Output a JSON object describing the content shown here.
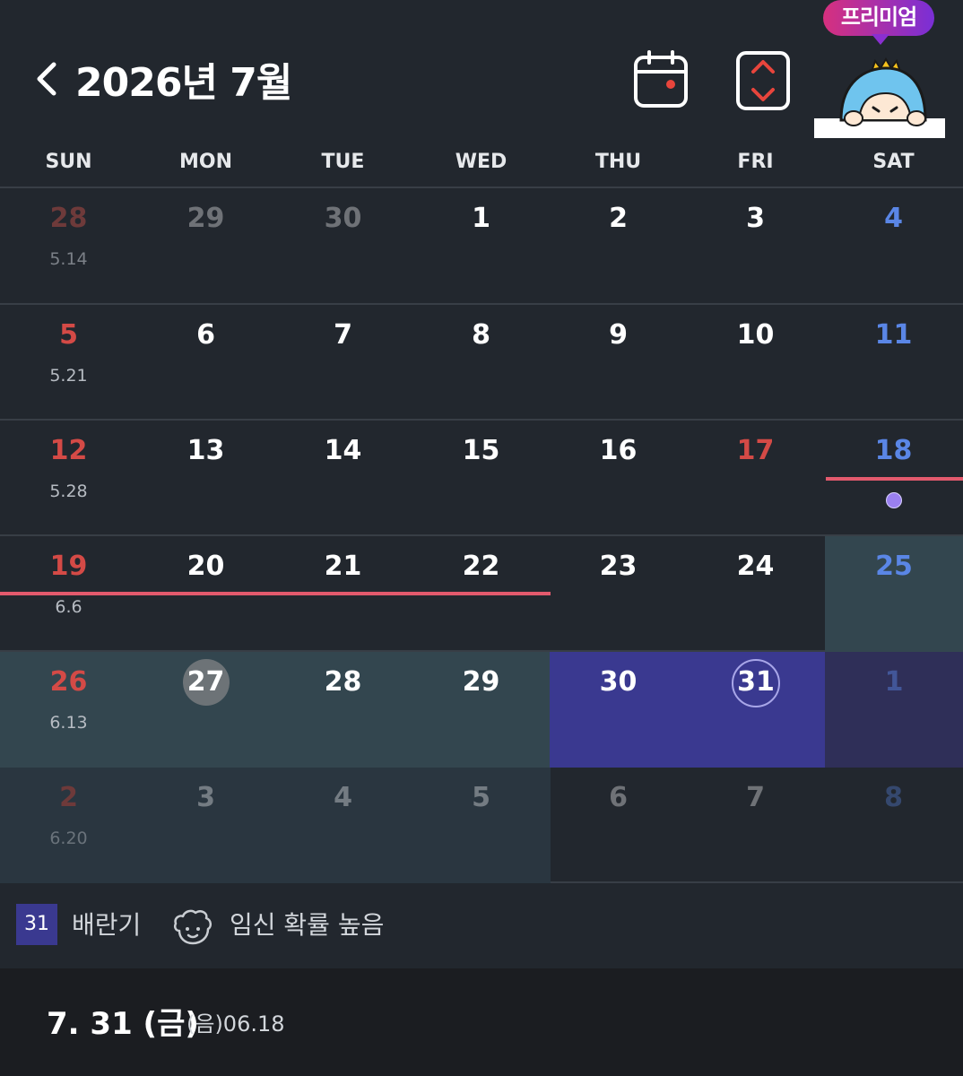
{
  "header": {
    "title": "2026년 7월",
    "back_icon": "chevron-left-icon",
    "calendar_icon": "calendar-icon",
    "expand_icon": "expand-collapse-icon",
    "premium_label": "프리미엄"
  },
  "weekdays": [
    "SUN",
    "MON",
    "TUE",
    "WED",
    "THU",
    "FRI",
    "SAT"
  ],
  "weeks": [
    [
      {
        "d": "28",
        "l": "5.14"
      },
      {
        "d": "29"
      },
      {
        "d": "30"
      },
      {
        "d": "1"
      },
      {
        "d": "2"
      },
      {
        "d": "3"
      },
      {
        "d": "4"
      }
    ],
    [
      {
        "d": "5",
        "l": "5.21"
      },
      {
        "d": "6"
      },
      {
        "d": "7"
      },
      {
        "d": "8"
      },
      {
        "d": "9"
      },
      {
        "d": "10"
      },
      {
        "d": "11"
      }
    ],
    [
      {
        "d": "12",
        "l": "5.28"
      },
      {
        "d": "13"
      },
      {
        "d": "14"
      },
      {
        "d": "15"
      },
      {
        "d": "16"
      },
      {
        "d": "17"
      },
      {
        "d": "18"
      }
    ],
    [
      {
        "d": "19",
        "l": "6.6"
      },
      {
        "d": "20"
      },
      {
        "d": "21"
      },
      {
        "d": "22"
      },
      {
        "d": "23"
      },
      {
        "d": "24"
      },
      {
        "d": "25"
      }
    ],
    [
      {
        "d": "26",
        "l": "6.13"
      },
      {
        "d": "27"
      },
      {
        "d": "28"
      },
      {
        "d": "29"
      },
      {
        "d": "30"
      },
      {
        "d": "31"
      },
      {
        "d": "1"
      }
    ],
    [
      {
        "d": "2",
        "l": "6.20"
      },
      {
        "d": "3"
      },
      {
        "d": "4"
      },
      {
        "d": "5"
      },
      {
        "d": "6"
      },
      {
        "d": "7"
      },
      {
        "d": "8"
      }
    ]
  ],
  "legend": {
    "box_label": "31",
    "ovulation_label": "배란기",
    "fertile_icon": "baby-face-icon",
    "fertile_label": "임신 확률 높음"
  },
  "selected": {
    "date": "7. 31 (금)",
    "lunar": "(음)06.18"
  },
  "colors": {
    "background": "#22272e",
    "sunday_holiday": "#d44a46",
    "saturday": "#5a86e6",
    "fertile_highlight": "#33464f",
    "ovulation_highlight": "#3a3990",
    "period_bar": "#e35a6d",
    "premium_gradient_start": "#d6307e",
    "premium_gradient_end": "#7a2fd6"
  }
}
